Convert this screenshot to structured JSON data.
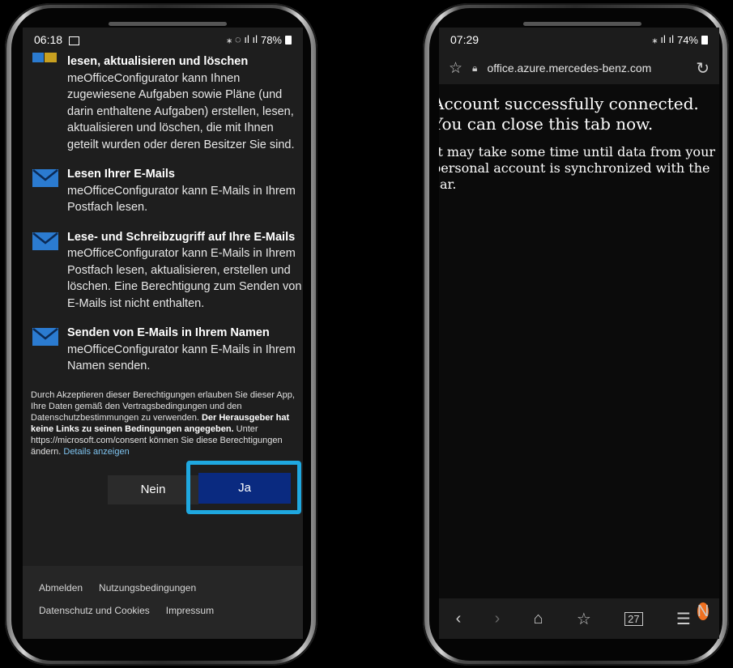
{
  "left_phone": {
    "status": {
      "time": "06:18",
      "battery": "78%"
    },
    "first_item_title": "lesen, aktualisieren und löschen",
    "first_item_desc": "meOfficeConfigurator kann Ihnen zugewiesene Aufgaben sowie Pläne (und darin enthaltene Aufgaben) erstellen, lesen, aktualisieren und löschen, die mit Ihnen geteilt wurden oder deren Besitzer Sie sind.",
    "permissions": [
      {
        "title": "Lesen Ihrer E-Mails",
        "desc": "meOfficeConfigurator kann E-Mails in Ihrem Postfach lesen.",
        "icon": "mail-icon"
      },
      {
        "title": "Lese- und Schreibzugriff auf Ihre E-Mails",
        "desc": "meOfficeConfigurator kann E-Mails in Ihrem Postfach lesen, aktualisieren, erstellen und löschen. Eine Berechtigung zum Senden von E-Mails ist nicht enthalten.",
        "icon": "mail-icon"
      },
      {
        "title": "Senden von E-Mails in Ihrem Namen",
        "desc": "meOfficeConfigurator kann E-Mails in Ihrem Namen senden.",
        "icon": "mail-icon"
      }
    ],
    "legal": {
      "part1": "Durch Akzeptieren dieser Berechtigungen erlauben Sie dieser App, Ihre Daten gemäß den Vertragsbedingungen und den Datenschutzbestimmungen zu verwenden.",
      "bold": "Der Herausgeber hat keine Links zu seinen Bedingungen angegeben.",
      "part2": "Unter https://microsoft.com/consent können Sie diese Berechtigungen ändern.",
      "link": "Details anzeigen"
    },
    "buttons": {
      "no": "Nein",
      "yes": "Ja"
    },
    "footer": {
      "signout": "Abmelden",
      "terms": "Nutzungsbedingungen",
      "privacy": "Datenschutz und Cookies",
      "imprint": "Impressum"
    },
    "colors": {
      "accent_frame": "#1fa8e0",
      "yes_button": "#0a2a80",
      "mail_icon": "#2b7bd0"
    }
  },
  "right_phone": {
    "status": {
      "time": "07:29",
      "battery": "74%"
    },
    "url": "office.azure.mercedes-benz.com",
    "message_title": "Account successfully connected. You can close this tab now.",
    "message_body": "It may take some time until data from your personal account is synchronized with the car.",
    "nav_badge": "N"
  }
}
